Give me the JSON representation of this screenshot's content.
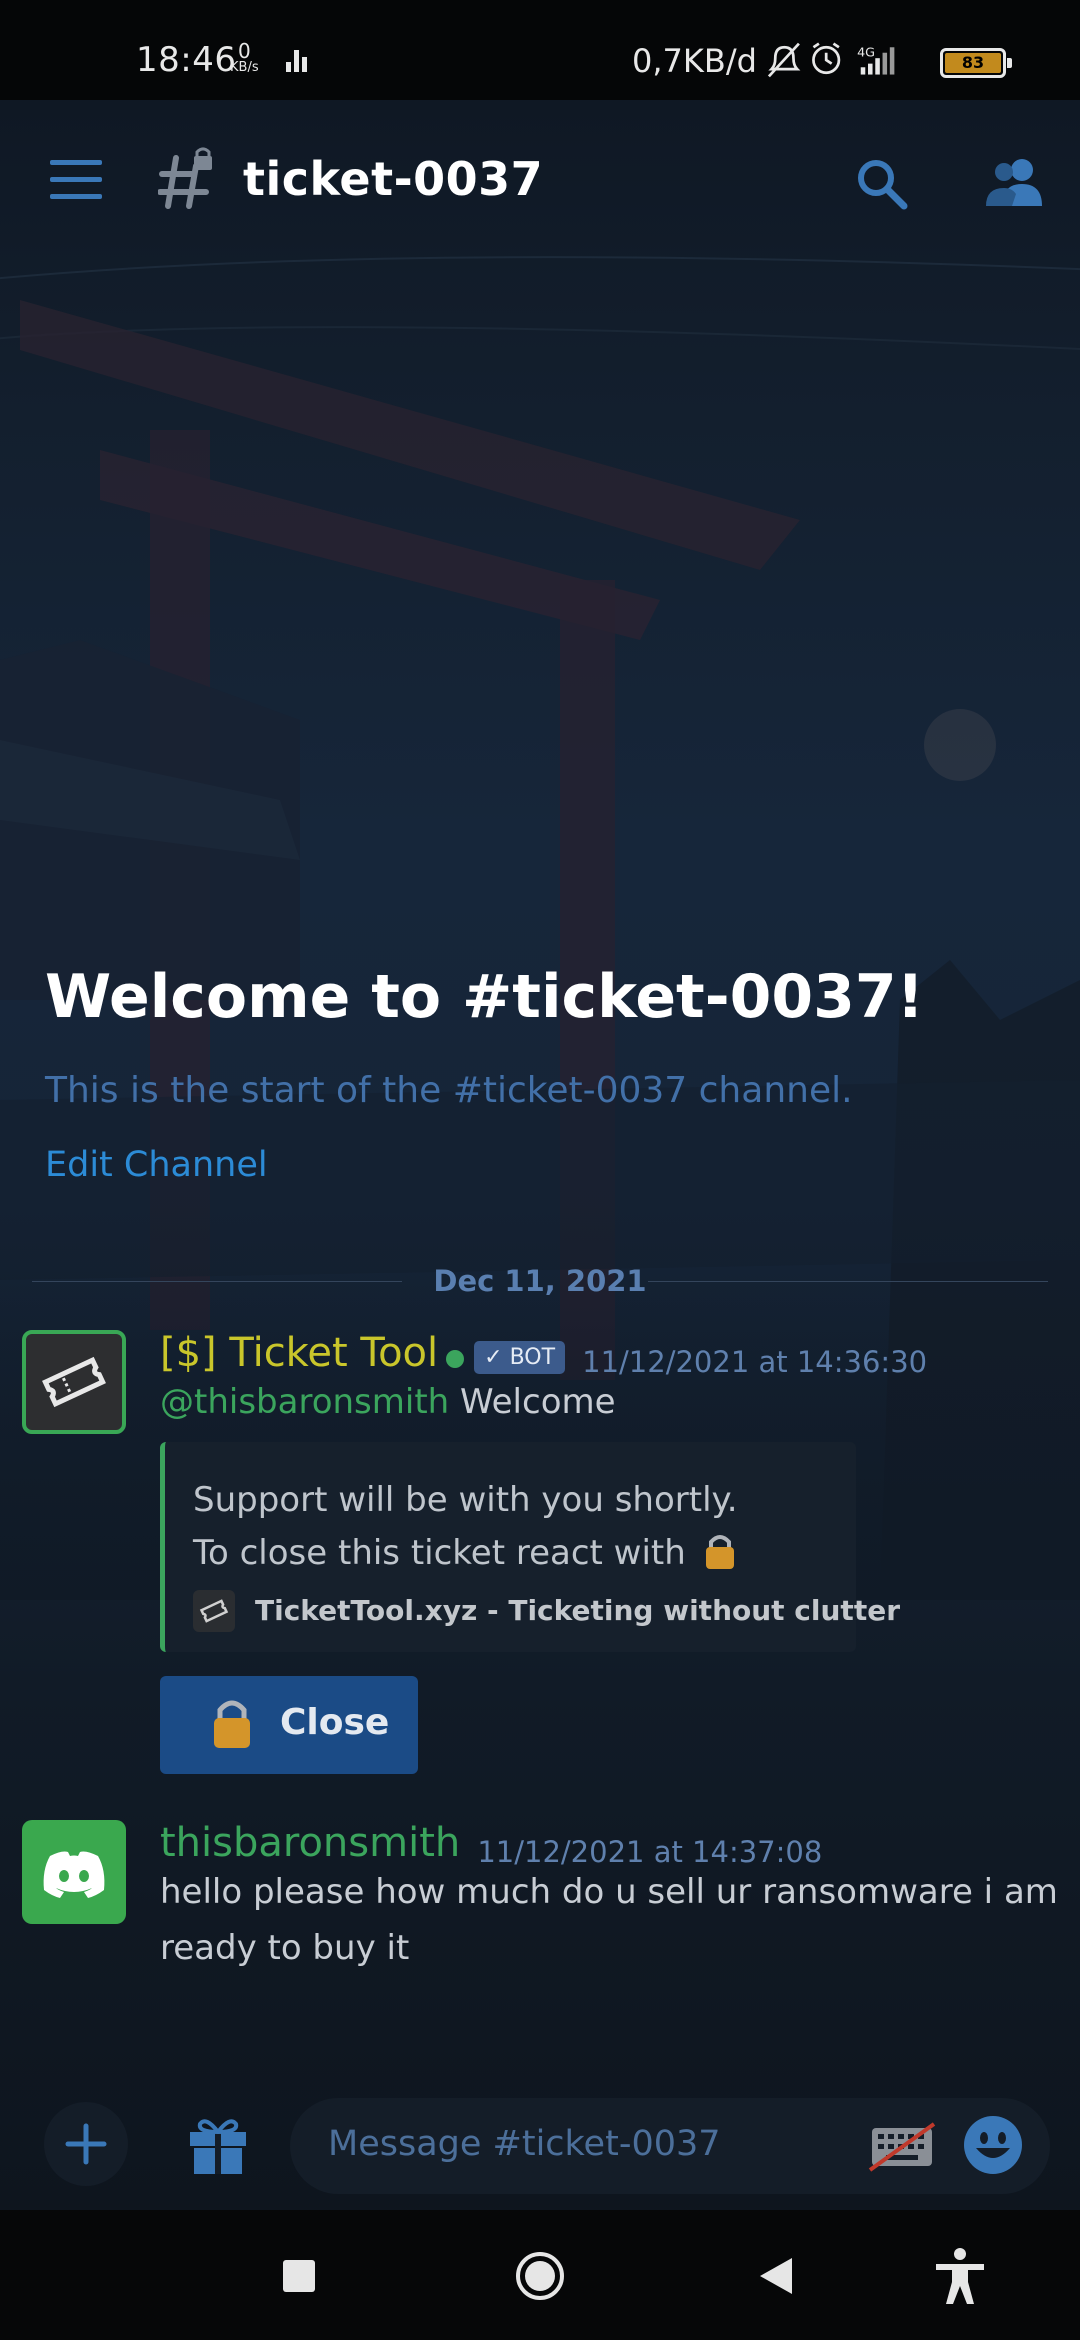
{
  "status_bar": {
    "time": "18:46",
    "net_speed_value": "0",
    "net_speed_unit": "KB/s",
    "data_rate": "0,7KB/d",
    "network_type": "4G",
    "battery": "83"
  },
  "header": {
    "channel_name": "ticket-0037"
  },
  "intro": {
    "welcome_title": "Welcome to #ticket-0037!",
    "welcome_sub": "This is the start of the #ticket-0037 channel.",
    "edit_channel": "Edit Channel"
  },
  "divider": {
    "date": "Dec 11, 2021"
  },
  "messages": [
    {
      "author": "[$] Ticket Tool",
      "bot_tag": "BOT",
      "timestamp": "11/12/2021 at 14:36:30",
      "mention": "@thisbaronsmith",
      "text": "Welcome",
      "embed": {
        "line1": "Support will be with you shortly.",
        "line2": "To close this ticket react with",
        "footer": "TicketTool.xyz - Ticketing without clutter"
      },
      "button_label": "Close"
    },
    {
      "author": "thisbaronsmith",
      "timestamp": "11/12/2021 at 14:37:08",
      "text_line1": "hello please how much do u sell ur ransomware i am",
      "text_line2": "ready to buy it"
    }
  ],
  "composer": {
    "placeholder": "Message #ticket-0037"
  },
  "colors": {
    "accent_blue": "#3a78b8",
    "bot_name": "#c9c62b",
    "online_green": "#3ba55d",
    "close_button": "#1b4b86",
    "lock": "#d4952a"
  },
  "icons": {
    "menu": "hamburger-icon",
    "channel": "locked-hash-icon",
    "search": "search-icon",
    "members": "members-icon",
    "add": "plus-icon",
    "gift": "gift-icon",
    "keyboard": "keyboard-off-icon",
    "emoji": "emoji-icon"
  }
}
